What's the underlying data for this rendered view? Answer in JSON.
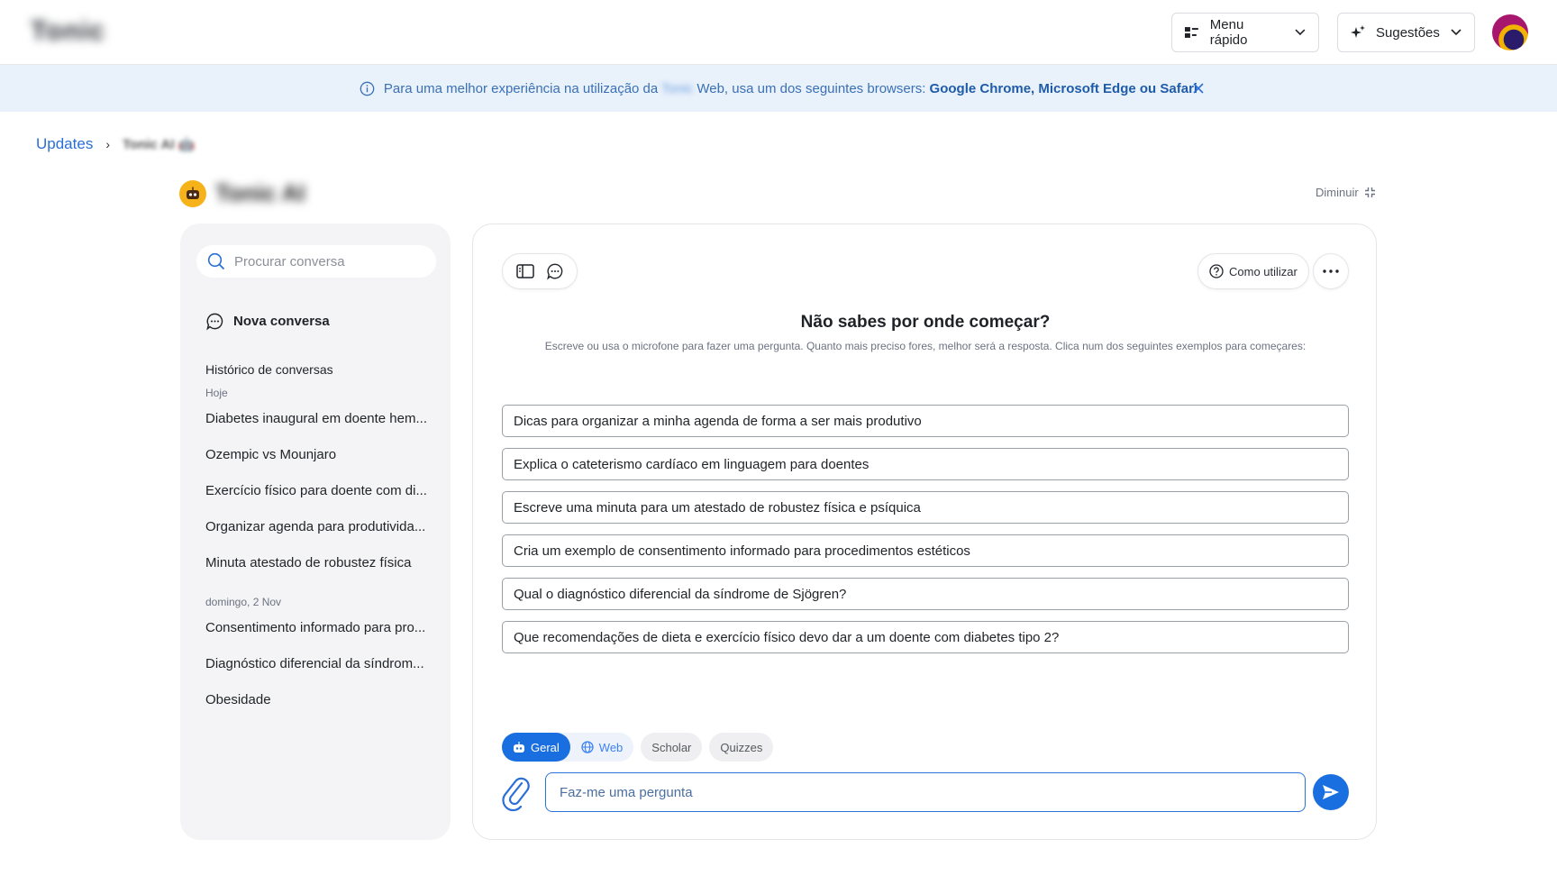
{
  "header": {
    "logo_text": "Tonic",
    "menu_label": "Menu rápido",
    "suggestions_label": "Sugestões"
  },
  "banner": {
    "text_before": "Para uma melhor experiência na utilização da",
    "brand_blurred": "Tonic",
    "text_middle": "Web, usa um dos seguintes browsers:",
    "browsers": "Google Chrome, Microsoft Edge ou Safari"
  },
  "breadcrumb": {
    "parent": "Updates",
    "current": "Tonic AI 🤖"
  },
  "page": {
    "title": "Tonic AI",
    "minimize_label": "Diminuir"
  },
  "sidebar": {
    "search_placeholder": "Procurar conversa",
    "new_conversation": "Nova conversa",
    "history_title": "Histórico de conversas",
    "groups": [
      {
        "label": "Hoje",
        "items": [
          "Diabetes inaugural em doente hem...",
          "Ozempic vs Mounjaro",
          "Exercício físico para doente com di...",
          "Organizar agenda para produtivida...",
          "Minuta atestado de robustez física"
        ]
      },
      {
        "label": "domingo, 2 Nov",
        "items": [
          "Consentimento informado para pro...",
          "Diagnóstico diferencial da síndrom...",
          "Obesidade"
        ]
      }
    ]
  },
  "main": {
    "how_to_label": "Como utilizar",
    "heading": "Não sabes por onde começar?",
    "subheading": "Escreve ou usa o microfone para fazer uma pergunta. Quanto mais preciso fores, melhor será a resposta. Clica num dos seguintes exemplos para começares:",
    "suggestions": [
      "Dicas para organizar a minha agenda de forma a ser mais produtivo",
      "Explica o cateterismo cardíaco em linguagem para doentes",
      "Escreve uma minuta para um atestado de robustez física e psíquica",
      "Cria um exemplo de consentimento informado para procedimentos estéticos",
      "Qual o diagnóstico diferencial da síndrome de Sjögren?",
      "Que recomendações de dieta e exercício físico devo dar a um doente com diabetes tipo 2?"
    ],
    "modes": {
      "geral": "Geral",
      "web": "Web",
      "scholar": "Scholar",
      "quizzes": "Quizzes"
    },
    "input_placeholder": "Faz-me uma pergunta"
  },
  "colors": {
    "accent": "#1a6fe0",
    "banner_bg": "#e9f1fb",
    "sidebar_bg": "#f4f4f6"
  }
}
